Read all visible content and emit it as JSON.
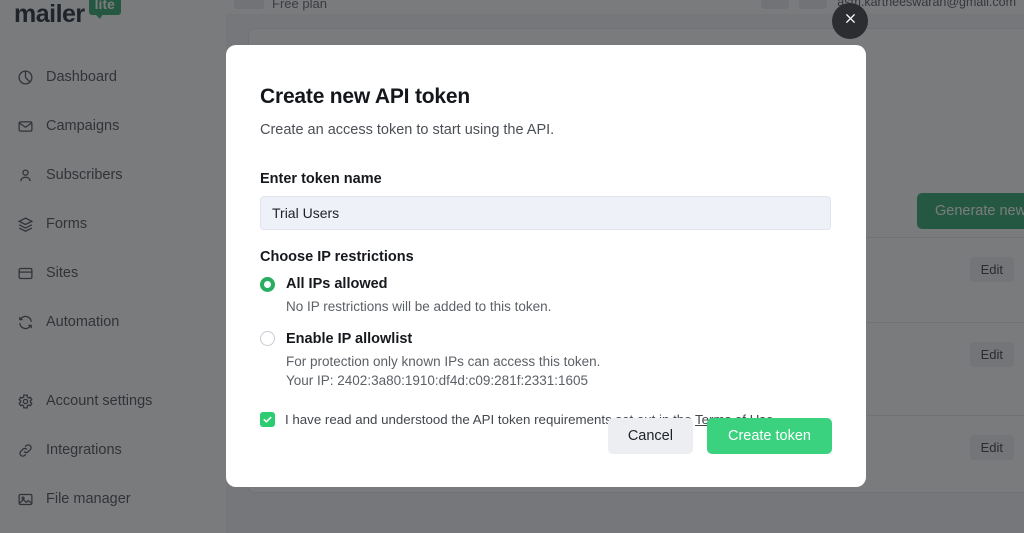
{
  "sidebar": {
    "logo": {
      "word": "mailer",
      "badge": "lite"
    },
    "items": [
      {
        "label": "Dashboard",
        "icon": "pie-chart-icon"
      },
      {
        "label": "Campaigns",
        "icon": "envelope-icon"
      },
      {
        "label": "Subscribers",
        "icon": "user-icon"
      },
      {
        "label": "Forms",
        "icon": "layers-icon"
      },
      {
        "label": "Sites",
        "icon": "window-icon"
      },
      {
        "label": "Automation",
        "icon": "refresh-icon"
      }
    ],
    "items_secondary": [
      {
        "label": "Account settings",
        "icon": "gear-icon"
      },
      {
        "label": "Integrations",
        "icon": "link-icon"
      },
      {
        "label": "File manager",
        "icon": "image-icon"
      }
    ]
  },
  "topbar": {
    "plan": "Free plan",
    "email": "asm.kartheeswaran@gmail.com"
  },
  "background": {
    "generate_button": "Generate new token",
    "edit_button": "Edit",
    "rows": [
      {
        "action": "Edit"
      },
      {
        "action": "Edit"
      },
      {
        "action": "Edit"
      }
    ]
  },
  "modal": {
    "title": "Create new API token",
    "subtitle": "Create an access token to start using the API.",
    "close_icon": "close-icon",
    "token_name": {
      "label": "Enter token name",
      "value": "Trial Users",
      "placeholder": "Enter token name"
    },
    "ip_restrictions": {
      "label": "Choose IP restrictions",
      "options": [
        {
          "label": "All IPs allowed",
          "help": "No IP restrictions will be added to this token.",
          "selected": true
        },
        {
          "label": "Enable IP allowlist",
          "help": "For protection only known IPs can access this token. Your IP: 2402:3a80:1910:df4d:c09:281f:2331:1605",
          "selected": false
        }
      ]
    },
    "terms": {
      "checked": true,
      "text_before": "I have read and understood the API token requirements set out in the ",
      "link": "Terms of Use",
      "text_after": "."
    },
    "cancel_label": "Cancel",
    "create_label": "Create token"
  },
  "colors": {
    "brand_green": "#21a366",
    "accent_green": "#3ad17f",
    "radio_green": "#27ae60",
    "input_bg": "#eef1f8",
    "overlay": "rgba(40,42,45,0.62)"
  }
}
